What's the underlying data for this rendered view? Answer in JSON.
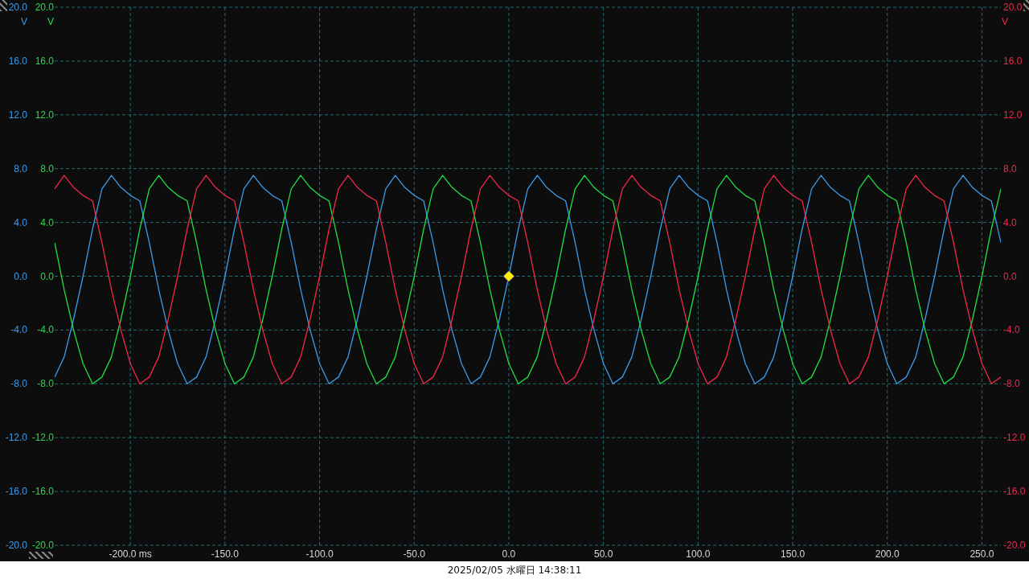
{
  "scope": {
    "axes": [
      {
        "unit": "V"
      },
      {
        "unit": "V",
        "ticks": [
          "20.0",
          "16.0",
          "12.0",
          "8.0",
          "4.0",
          "0.0",
          "-4.0",
          "-8.0",
          "-12.0",
          "-16.0",
          "-20.0"
        ]
      },
      {
        "unit": "V",
        "ticks": [
          "20.0",
          "16.0",
          "12.0",
          "8.0",
          "4.0",
          "0.0",
          "-4.0",
          "-8.0",
          "-12.0",
          "-16.0",
          "-20.0"
        ]
      }
    ],
    "chart_data": {
      "type": "line",
      "xlim": [
        -240,
        260
      ],
      "ylim": [
        -20,
        20
      ],
      "yticks": [
        {
          "value": 20,
          "label": "20.0"
        },
        {
          "value": 16,
          "label": "16.0"
        },
        {
          "value": 12,
          "label": "12.0"
        },
        {
          "value": 8,
          "label": "8.0"
        },
        {
          "value": 4,
          "label": "4.0"
        },
        {
          "value": 0,
          "label": "0.0"
        },
        {
          "value": -4,
          "label": "-4.0"
        },
        {
          "value": -8,
          "label": "-8.0"
        },
        {
          "value": -12,
          "label": "-12.0"
        },
        {
          "value": -16,
          "label": "-16.0"
        },
        {
          "value": -20,
          "label": "-20.0"
        }
      ],
      "xticks": [
        {
          "value": -200,
          "label": "-200.0 ms"
        },
        {
          "value": -150,
          "label": "-150.0"
        },
        {
          "value": -100,
          "label": "-100.0"
        },
        {
          "value": -50,
          "label": "-50.0"
        },
        {
          "value": 0,
          "label": "0.0"
        },
        {
          "value": 50,
          "label": "50.0"
        },
        {
          "value": 100,
          "label": "100.0"
        },
        {
          "value": 150,
          "label": "150.0"
        },
        {
          "value": 200,
          "label": "200.0"
        },
        {
          "value": 250,
          "label": "250.0"
        }
      ],
      "x": [
        -240,
        -235,
        -230,
        -225,
        -220,
        -215,
        -210,
        -205,
        -200,
        -195,
        -190,
        -185,
        -180,
        -175,
        -170,
        -165,
        -160,
        -155,
        -150,
        -145,
        -140,
        -135,
        -130,
        -125,
        -120,
        -115,
        -110,
        -105,
        -100,
        -95,
        -90,
        -85,
        -80,
        -75,
        -70,
        -65,
        -60,
        -55,
        -50,
        -45,
        -40,
        -35,
        -30,
        -25,
        -20,
        -15,
        -10,
        -5,
        0,
        5,
        10,
        15,
        20,
        25,
        30,
        35,
        40,
        45,
        50,
        55,
        60,
        65,
        70,
        75,
        80,
        85,
        90,
        95,
        100,
        105,
        110,
        115,
        120,
        125,
        130,
        135,
        140,
        145,
        150,
        155,
        160,
        165,
        170,
        175,
        180,
        185,
        190,
        195,
        200,
        205,
        210,
        215,
        220,
        225,
        230,
        235,
        240,
        245,
        250,
        255,
        260
      ],
      "series": [
        {
          "color": "#3d9be9",
          "values": [
            -7.5,
            -6.0,
            -3.2,
            0,
            3.5,
            6.5,
            7.5,
            6.6,
            6.0,
            5.6,
            2.5,
            -1.0,
            -4.0,
            -6.5,
            -8.0,
            -7.5,
            -6.0,
            -3.2,
            0,
            3.5,
            6.5,
            7.5,
            6.6,
            6.0,
            5.6,
            2.5,
            -1.0,
            -4.0,
            -6.5,
            -8.0,
            -7.5,
            -6.0,
            -3.2,
            0,
            3.5,
            6.5,
            7.5,
            6.6,
            6.0,
            5.6,
            2.5,
            -1.0,
            -4.0,
            -6.5,
            -8.0,
            -7.5,
            -6.0,
            -3.2,
            0,
            3.5,
            6.5,
            7.5,
            6.6,
            6.0,
            5.6,
            2.5,
            -1.0,
            -4.0,
            -6.5,
            -8.0,
            -7.5,
            -6.0,
            -3.2,
            0,
            3.5,
            6.5,
            7.5,
            6.6,
            6.0,
            5.6,
            2.5,
            -1.0,
            -4.0,
            -6.5,
            -8.0,
            -7.5,
            -6.0,
            -3.2,
            0,
            3.5,
            6.5,
            7.5,
            6.6,
            6.0,
            5.6,
            2.5,
            -1.0,
            -4.0,
            -6.5,
            -8.0,
            -7.5,
            -6.0,
            -3.2,
            0,
            3.5,
            6.5,
            7.5,
            6.6,
            6.0,
            5.6,
            2.5
          ]
        },
        {
          "color": "#22dd44",
          "values": [
            2.5,
            -1.0,
            -4.0,
            -6.5,
            -8.0,
            -7.5,
            -6.0,
            -3.2,
            0,
            3.5,
            6.5,
            7.5,
            6.6,
            6.0,
            5.6,
            2.5,
            -1.0,
            -4.0,
            -6.5,
            -8.0,
            -7.5,
            -6.0,
            -3.2,
            0,
            3.5,
            6.5,
            7.5,
            6.6,
            6.0,
            5.6,
            2.5,
            -1.0,
            -4.0,
            -6.5,
            -8.0,
            -7.5,
            -6.0,
            -3.2,
            0,
            3.5,
            6.5,
            7.5,
            6.6,
            6.0,
            5.6,
            2.5,
            -1.0,
            -4.0,
            -6.5,
            -8.0,
            -7.5,
            -6.0,
            -3.2,
            0,
            3.5,
            6.5,
            7.5,
            6.6,
            6.0,
            5.6,
            2.5,
            -1.0,
            -4.0,
            -6.5,
            -8.0,
            -7.5,
            -6.0,
            -3.2,
            0,
            3.5,
            6.5,
            7.5,
            6.6,
            6.0,
            5.6,
            2.5,
            -1.0,
            -4.0,
            -6.5,
            -8.0,
            -7.5,
            -6.0,
            -3.2,
            0,
            3.5,
            6.5,
            7.5,
            6.6,
            6.0,
            5.6,
            2.5,
            -1.0,
            -4.0,
            -6.5,
            -8.0,
            -7.5,
            -6.0,
            -3.2,
            0,
            3.5,
            6.5
          ]
        },
        {
          "color": "#f0284a",
          "values": [
            6.5,
            7.5,
            6.6,
            6.0,
            5.6,
            2.5,
            -1.0,
            -4.0,
            -6.5,
            -8.0,
            -7.5,
            -6.0,
            -3.2,
            0,
            3.5,
            6.5,
            7.5,
            6.6,
            6.0,
            5.6,
            2.5,
            -1.0,
            -4.0,
            -6.5,
            -8.0,
            -7.5,
            -6.0,
            -3.2,
            0,
            3.5,
            6.5,
            7.5,
            6.6,
            6.0,
            5.6,
            2.5,
            -1.0,
            -4.0,
            -6.5,
            -8.0,
            -7.5,
            -6.0,
            -3.2,
            0,
            3.5,
            6.5,
            7.5,
            6.6,
            6.0,
            5.6,
            2.5,
            -1.0,
            -4.0,
            -6.5,
            -8.0,
            -7.5,
            -6.0,
            -3.2,
            0,
            3.5,
            6.5,
            7.5,
            6.6,
            6.0,
            5.6,
            2.5,
            -1.0,
            -4.0,
            -6.5,
            -8.0,
            -7.5,
            -6.0,
            -3.2,
            0,
            3.5,
            6.5,
            7.5,
            6.6,
            6.0,
            5.6,
            2.5,
            -1.0,
            -4.0,
            -6.5,
            -8.0,
            -7.5,
            -6.0,
            -3.2,
            0,
            3.5,
            6.5,
            7.5,
            6.6,
            6.0,
            5.6,
            2.5,
            -1.0,
            -4.0,
            -6.5,
            -8.0,
            -7.5
          ]
        }
      ],
      "grid": true
    },
    "trigger_marker": true,
    "timestamp": "2025/02/05 水曜日 14:38:11"
  }
}
